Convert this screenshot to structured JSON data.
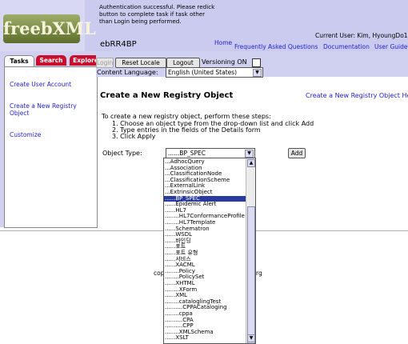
{
  "header": {
    "logo_text": "freebXML",
    "auth_message": "Authentication successful. Please redick button to complete task if task other than Login being performed.",
    "app_title": "ebRR4BP",
    "current_user": "Current User: Kim, HyoungDo1",
    "links": {
      "home": "Home",
      "faq": "Frequently Asked Questions",
      "documentation": "Documentation",
      "user_guide": "User Guide"
    }
  },
  "sidebar": {
    "tabs": [
      "Tasks",
      "Search",
      "Explore"
    ],
    "active_tab": "Tasks",
    "tasks": [
      "Create User Account",
      "Create a New Registry Object",
      "Customize"
    ]
  },
  "toolbar": {
    "login": "Login",
    "reset_locale": "Reset Locale",
    "logout": "Logout",
    "versioning_label": "Versioning ON",
    "versioning_checked": false,
    "content_language_label": "Content Language:",
    "content_language_value": "English (United States)"
  },
  "main": {
    "title": "Create a New Registry Object",
    "help_link": "Create a New Registry Object Help",
    "instructions_intro": "To create a new registry object, perform these steps:",
    "steps": [
      "1.  Choose an object type from the drop-down list and click Add",
      "2.  Type entries in the fields of the Details form",
      "3.  Click Apply"
    ],
    "object_type_label": "Object Type:",
    "object_type_value": "......BP_SPEC",
    "add_button": "Add"
  },
  "footer": {
    "left_fragment": "cop",
    "right_fragment": "rg"
  },
  "dropdown": {
    "selected_index": 7,
    "options": [
      "...AdhocQuery",
      "...Association",
      "...ClassificationNode",
      "...ClassificationScheme",
      "...ExternalLink",
      "...ExtrinsicObject",
      "......BP_SPEC",
      "......Epidemic Alert",
      "......HL7",
      "........HL7ConformanceProfile",
      "........HL7Template",
      "......Schematron",
      "......WSDL",
      "......바인딩",
      "......포트",
      "......포트 유형",
      "......서비스",
      "......XACML",
      "........Policy",
      "........PolicySet",
      "......XHTML",
      "........XForm",
      "......XML",
      "........cataloglingTest",
      "..........CPPACataloging",
      "........cppa",
      "..........CPA",
      "..........CPP",
      "........XMLSchema",
      "......XSLT"
    ]
  }
}
